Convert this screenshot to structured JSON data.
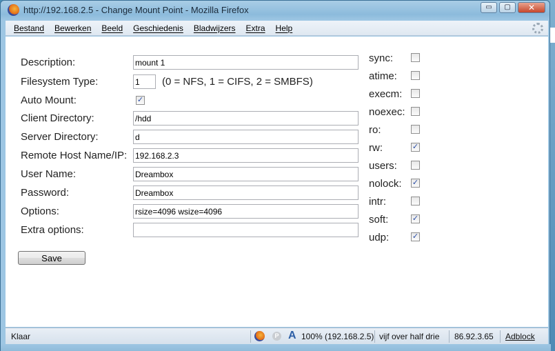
{
  "window": {
    "title": "http://192.168.2.5 - Change Mount Point - Mozilla Firefox",
    "minimize_glyph": "▭",
    "maximize_glyph": "▢",
    "close_glyph": "✕"
  },
  "menubar": {
    "items": [
      "Bestand",
      "Bewerken",
      "Beeld",
      "Geschiedenis",
      "Bladwijzers",
      "Extra",
      "Help"
    ]
  },
  "form": {
    "description": {
      "label": "Description:",
      "value": "mount 1"
    },
    "fstype": {
      "label": "Filesystem Type:",
      "value": "1",
      "hint": "(0 = NFS, 1 = CIFS, 2 = SMBFS)"
    },
    "automount": {
      "label": "Auto Mount:",
      "checked": true
    },
    "client_dir": {
      "label": "Client Directory:",
      "value": "/hdd"
    },
    "server_dir": {
      "label": "Server Directory:",
      "value": "d"
    },
    "remote_host": {
      "label": "Remote Host Name/IP:",
      "value": "192.168.2.3"
    },
    "username": {
      "label": "User Name:",
      "value": "Dreambox"
    },
    "password": {
      "label": "Password:",
      "value": "Dreambox"
    },
    "options": {
      "label": "Options:",
      "value": "rsize=4096 wsize=4096"
    },
    "extra_options": {
      "label": "Extra options:",
      "value": ""
    },
    "save_label": "Save"
  },
  "mount_options": [
    {
      "label": "sync:",
      "checked": false
    },
    {
      "label": "atime:",
      "checked": false
    },
    {
      "label": "execm:",
      "checked": false
    },
    {
      "label": "noexec:",
      "checked": false
    },
    {
      "label": "ro:",
      "checked": false
    },
    {
      "label": "rw:",
      "checked": true
    },
    {
      "label": "users:",
      "checked": false
    },
    {
      "label": "nolock:",
      "checked": true
    },
    {
      "label": "intr:",
      "checked": false
    },
    {
      "label": "soft:",
      "checked": true
    },
    {
      "label": "udp:",
      "checked": true
    }
  ],
  "statusbar": {
    "status": "Klaar",
    "zoom": "100% (192.168.2.5)",
    "time": "vijf over half drie",
    "ip": "86.92.3.65",
    "adblock": "Adblock"
  },
  "colors": {
    "desktop": "#4a8fb8",
    "titlebar": "#9dc6e3",
    "checkmark": "#2a4ea6"
  }
}
